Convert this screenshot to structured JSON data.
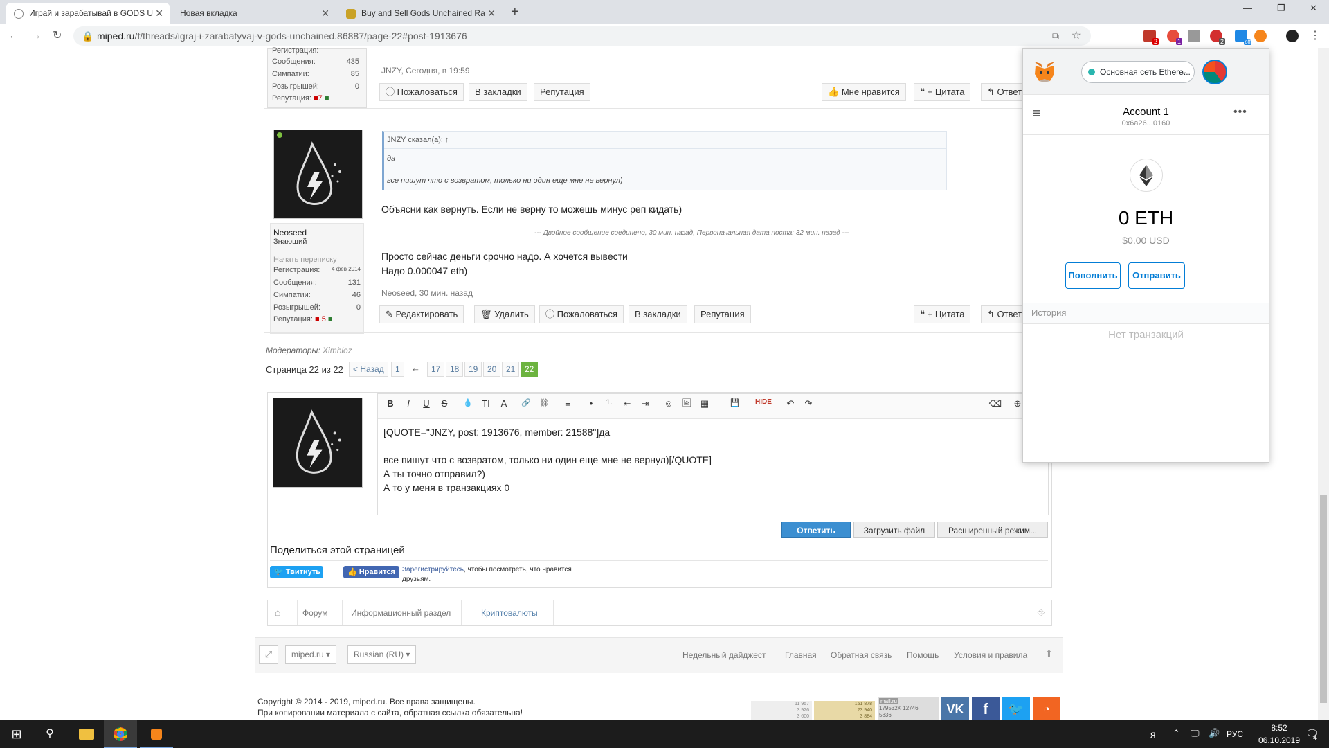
{
  "browser": {
    "tabs": [
      {
        "title": "Играй и зарабатывай в GODS U",
        "active": true
      },
      {
        "title": "Новая вкладка",
        "active": false
      },
      {
        "title": "Buy and Sell Gods Unchained Ra",
        "active": false
      }
    ],
    "new_tab": "+",
    "url_host": "miped.ru",
    "url_path": "/f/threads/igraj-i-zarabatyvaj-v-gods-unchained.86887/page-22#post-1913676",
    "window_controls": [
      "—",
      "❐",
      "✕"
    ],
    "ext_badges": [
      "2",
      "1",
      "2",
      "off"
    ]
  },
  "post1": {
    "stats": [
      {
        "label": "Регистрация:",
        "value": ""
      },
      {
        "label": "Сообщения:",
        "value": "435"
      },
      {
        "label": "Симпатии:",
        "value": "85"
      },
      {
        "label": "Розыгрышей:",
        "value": "0"
      },
      {
        "label": "Репутация:",
        "value": "7"
      }
    ],
    "meta": "JNZY, Сегодня, в 19:59",
    "buttons_left": [
      "Пожаловаться",
      "В закладки",
      "Репутация"
    ],
    "buttons_right": [
      "Мне нравится",
      "+ Цитата",
      "Ответ"
    ]
  },
  "post2": {
    "username": "Neoseed",
    "usertitle": "Знающий",
    "start_conversation": "Начать переписку",
    "stats": [
      {
        "label": "Регистрация:",
        "value": "4 фев 2014"
      },
      {
        "label": "Сообщения:",
        "value": "131"
      },
      {
        "label": "Симпатии:",
        "value": "46"
      },
      {
        "label": "Розыгрышей:",
        "value": "0"
      },
      {
        "label": "Репутация:",
        "value": "5"
      }
    ],
    "quote_author": "JNZY сказал(а): ↑",
    "quote_line1": "да",
    "quote_line2": "все пишут что с возвратом, только ни один еще мне не вернул)",
    "text1": "Объясни как вернуть. Если не верну то можешь минус реп кидать)",
    "merged_prefix": "--- Двойное сообщение соединено, ",
    "merged_time": "30 мин. назад",
    "merged_mid": ", Первоначальная дата поста: ",
    "merged_orig": "32 мин. назад",
    "merged_suffix": " ---",
    "text2_line1": "Просто сейчас деньги срочно надо. А хочется вывести",
    "text2_line2": "Надо 0.000047 eth)",
    "meta": "Neoseed, 30 мин. назад",
    "buttons_left": [
      "Редактировать",
      "Удалить",
      "Пожаловаться",
      "В закладки",
      "Репутация"
    ],
    "buttons_right": [
      "+ Цитата",
      "Ответ"
    ]
  },
  "moderators_label": "Модераторы:",
  "moderators_name": "Ximbioz",
  "pagination": {
    "label": "Страница 22 из 22",
    "prev": "< Назад",
    "pages": [
      "1",
      "←",
      "17",
      "18",
      "19",
      "20",
      "21",
      "22"
    ]
  },
  "editor": {
    "toolbar": [
      "B",
      "I",
      "U",
      "S",
      "💧",
      "TI",
      "A",
      "🔗",
      "⛓",
      "≡",
      "•",
      "1.",
      "⇤",
      "⇥",
      "☺",
      "🖼",
      "▦",
      "💾",
      "HIDE",
      "↶",
      "↷",
      "⌫",
      "⊕"
    ],
    "line1": "[QUOTE=\"JNZY, post: 1913676, member: 21588\"]да",
    "line2": "все пишут что с  возвратом, только ни один еще мне не вернул)[/QUOTE]",
    "line3": "А ты точно отправил?)",
    "line4": "А то у  меня в транзакциях 0",
    "reply": "Ответить",
    "upload": "Загрузить файл",
    "advanced": "Расширенный режим..."
  },
  "share": {
    "title": "Поделиться этой страницей",
    "tweet": "Твитнуть",
    "like": "Нравится",
    "register": "Зарегистрируйтесь",
    "register_rest": ", чтобы посмотреть, что нравится",
    "register_rest2": "друзьям."
  },
  "breadcrumb": [
    "Форум",
    "Информационный раздел",
    "Криптовалюты"
  ],
  "footer": {
    "style": "miped.ru",
    "lang": "Russian (RU)",
    "links": [
      "Недельный дайджест",
      "Главная",
      "Обратная связь",
      "Помощь",
      "Условия и правила"
    ],
    "copyright": "Copyright © 2014 - 2019, miped.ru. Все права защищены.",
    "copy_note": "При копировании материала с сайта, обратная ссылка обязательна!",
    "counters": [
      "11 957",
      "3 926",
      "3 600",
      "151 878",
      "23 940",
      "3 884",
      "mail.ru",
      "179532K",
      "12746",
      "5836",
      "VK",
      "f"
    ]
  },
  "metamask": {
    "network": "Основная сеть Ethere...",
    "account": "Account 1",
    "address": "0x6a26...0160",
    "balance": "0 ETH",
    "usd": "$0.00 USD",
    "deposit": "Пополнить",
    "send": "Отправить",
    "history": "История",
    "no_tx": "Нет транзакций"
  },
  "taskbar": {
    "lang": "РУС",
    "time": "8:52",
    "date": "06.10.2019",
    "notif_count": "4"
  },
  "colors": {
    "accent_blue": "#3c8fd1",
    "page_active": "#6cb33f",
    "metamask_blue": "#037dd6",
    "online_dot": "#7fc241"
  }
}
